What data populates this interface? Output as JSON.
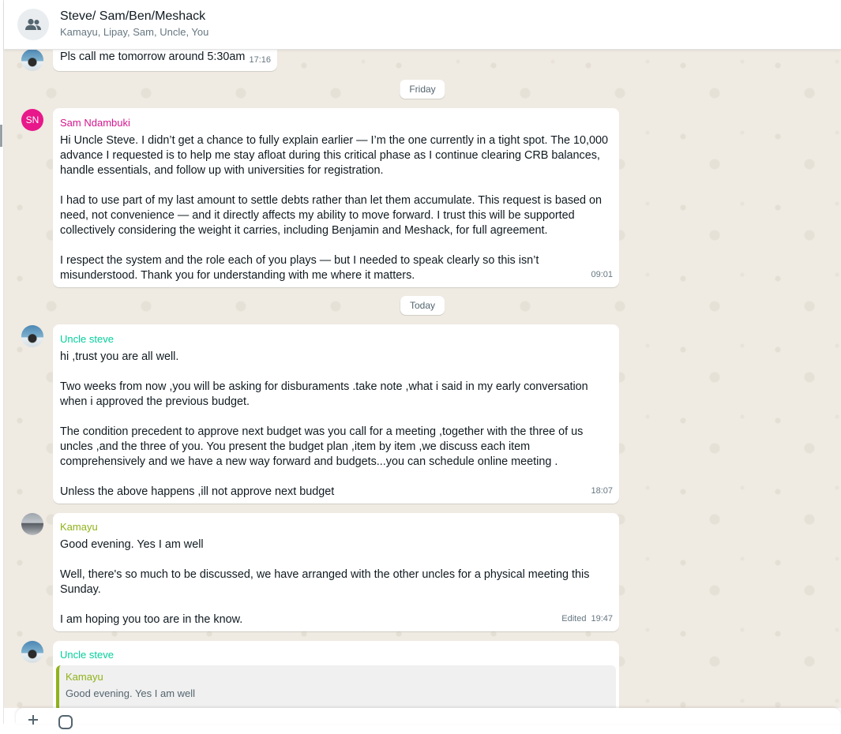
{
  "header": {
    "title": "Steve/ Sam/Ben/Meshack",
    "members": "Kamayu, Lipay, Sam, Uncle, You"
  },
  "messages": [
    {
      "text": "Pls call me tomorrow around 5:30am",
      "time": "17:16"
    },
    {
      "divider": "Friday"
    },
    {
      "initials": "SN",
      "sender": "Sam Ndambuki",
      "paragraphs": [
        "Hi Uncle Steve. I didn’t get a chance to fully explain earlier — I’m the one currently in a tight spot. The 10,000 advance I requested is to help me stay afloat during this critical phase as I continue clearing CRB balances, handle essentials, and follow up with universities for registration.",
        "I had to use part of my last amount to settle debts rather than let them accumulate. This request is based on need, not convenience — and it directly affects my ability to move forward. I trust this will be supported collectively considering the weight it carries, including Benjamin and Meshack, for full agreement.",
        "I respect the system and the role each of you plays — but I needed to speak clearly so this isn’t misunderstood. Thank you for understanding with me where it matters."
      ],
      "time": "09:01"
    },
    {
      "divider": "Today"
    },
    {
      "sender": "Uncle steve",
      "paragraphs": [
        "hi ,trust you are all well.",
        "Two weeks from now ,you will be asking for disburaments .take note ,what i said in my early conversation when i approved the previous budget.",
        "The condition precedent to approve next budget was you call for a meeting ,together with the three of us uncles ,and the three of you. You present the budget plan ,item by item ,we discuss each item comprehensively and we have a new way forward and budgets...you can schedule online meeting .",
        "Unless the above happens ,ill not approve next budget"
      ],
      "time": "18:07"
    },
    {
      "sender": "Kamayu",
      "paragraphs": [
        "Good evening. Yes I am well",
        "Well, there's so much to be discussed, we have arranged with the other uncles for a physical meeting this Sunday.",
        "I am hoping you too are in the know."
      ],
      "edited_label": "Edited",
      "time": "19:47"
    },
    {
      "sender": "Uncle steve",
      "quote": {
        "sender": "Kamayu",
        "text": "Good evening. Yes I am well"
      }
    }
  ],
  "colors": {
    "chat_background": "#efeae2",
    "sam": "#d3178e",
    "steve": "#06cf9c",
    "kamayu": "#8fb31a"
  },
  "icons": [
    "group-icon",
    "plus-icon",
    "sticker-icon"
  ]
}
